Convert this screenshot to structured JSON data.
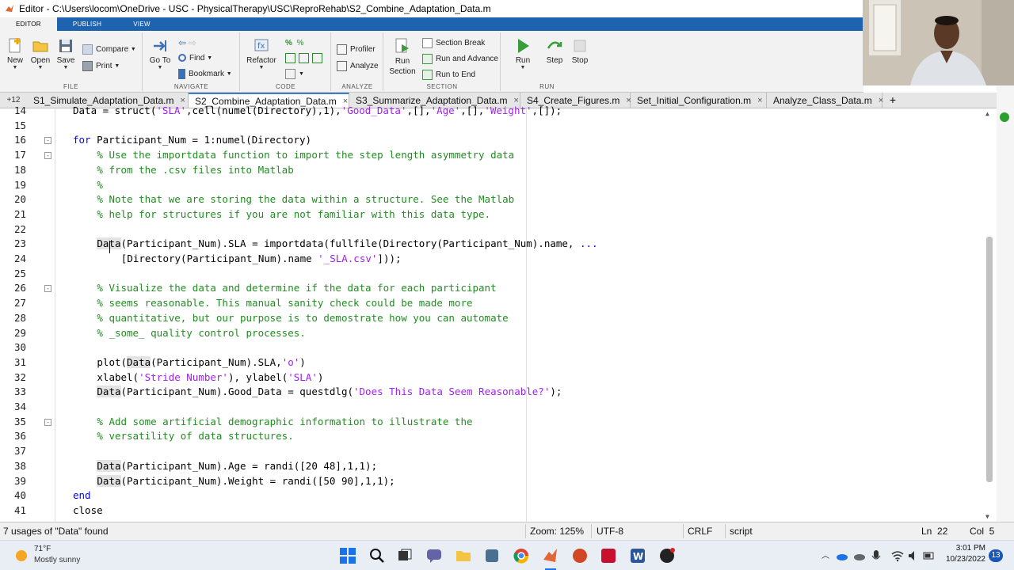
{
  "window": {
    "title": "Editor - C:\\Users\\locom\\OneDrive - USC - PhysicalTherapy\\USC\\ReproRehab\\S2_Combine_Adaptation_Data.m"
  },
  "toolstrip_tabs": [
    "EDITOR",
    "PUBLISH",
    "VIEW"
  ],
  "ribbon": {
    "file": {
      "label": "FILE",
      "new": "New",
      "open": "Open",
      "save": "Save",
      "compare": "Compare",
      "print": "Print"
    },
    "navigate": {
      "label": "NAVIGATE",
      "goto": "Go To",
      "find": "Find",
      "bookmark": "Bookmark"
    },
    "code": {
      "label": "CODE",
      "refactor": "Refactor"
    },
    "analyze": {
      "label": "ANALYZE",
      "profiler": "Profiler",
      "analyze": "Analyze"
    },
    "section": {
      "label": "SECTION",
      "run_section": "Run\nSection",
      "section_break": "Section Break",
      "run_and_advance": "Run and Advance",
      "run_to_end": "Run to End"
    },
    "run": {
      "label": "RUN",
      "run": "Run",
      "step": "Step",
      "stop": "Stop"
    }
  },
  "doc_tabs": {
    "overflow": "+12",
    "items": [
      {
        "label": "S1_Simulate_Adaptation_Data.m",
        "active": false
      },
      {
        "label": "S2_Combine_Adaptation_Data.m",
        "active": true
      },
      {
        "label": "S3_Summarize_Adaptation_Data.m",
        "active": false
      },
      {
        "label": "S4_Create_Figures.m",
        "active": false
      },
      {
        "label": "Set_Initial_Configuration.m",
        "active": false
      },
      {
        "label": "Analyze_Class_Data.m",
        "active": false
      }
    ],
    "add": "+"
  },
  "code_lines": [
    {
      "n": "14",
      "html": "Data = struct(<span class='str'>'SLA'</span>,cell(numel(Directory),1),<span class='str'>'Good_Data'</span>,[],<span class='str'>'Age'</span>,[],<span class='str'>'Weight'</span>,[]);",
      "indent": 0
    },
    {
      "n": "15",
      "html": "",
      "indent": 0
    },
    {
      "n": "16",
      "html": "<span class='kw'>for</span> Participant_Num = 1:numel(Directory)",
      "indent": 0,
      "fold": "-"
    },
    {
      "n": "17",
      "html": "<span class='cmt'>% Use the importdata function to import the step length asymmetry data</span>",
      "indent": 4,
      "fold": "-"
    },
    {
      "n": "18",
      "html": "<span class='cmt'>% from the .csv files into Matlab</span>",
      "indent": 4
    },
    {
      "n": "19",
      "html": "<span class='cmt'>%</span>",
      "indent": 4
    },
    {
      "n": "20",
      "html": "<span class='cmt'>% Note that we are storing the data within a structure. See the Matlab</span>",
      "indent": 4
    },
    {
      "n": "21",
      "html": "<span class='cmt'>% help for structures if you are not familiar with this data type.</span>",
      "indent": 4
    },
    {
      "n": "22",
      "html": "",
      "indent": 0
    },
    {
      "n": "23",
      "html": "<span class='hl'>Data</span>(Participant_Num).SLA = importdata(fullfile(Directory(Participant_Num).name, <span class='kw'>...</span>",
      "indent": 4
    },
    {
      "n": "24",
      "html": "[Directory(Participant_Num).name <span class='str'>'_SLA.csv'</span>]));",
      "indent": 8
    },
    {
      "n": "25",
      "html": "",
      "indent": 0
    },
    {
      "n": "26",
      "html": "<span class='cmt'>% Visualize the data and determine if the data for each participant</span>",
      "indent": 4,
      "fold": "-"
    },
    {
      "n": "27",
      "html": "<span class='cmt'>% seems reasonable. This manual sanity check could be made more</span>",
      "indent": 4
    },
    {
      "n": "28",
      "html": "<span class='cmt'>% quantitative, but our purpose is to demostrate how you can automate</span>",
      "indent": 4
    },
    {
      "n": "29",
      "html": "<span class='cmt'>% _some_ quality control processes.</span>",
      "indent": 4
    },
    {
      "n": "30",
      "html": "",
      "indent": 0
    },
    {
      "n": "31",
      "html": "plot(<span class='hl'>Data</span>(Participant_Num).SLA,<span class='str'>'o'</span>)",
      "indent": 4
    },
    {
      "n": "32",
      "html": "xlabel(<span class='str'>'Stride Number'</span>), ylabel(<span class='str'>'SLA'</span>)",
      "indent": 4
    },
    {
      "n": "33",
      "html": "<span class='hl'>Data</span>(Participant_Num).Good_Data = questdlg(<span class='str'>'Does This Data Seem Reasonable?'</span>);",
      "indent": 4
    },
    {
      "n": "34",
      "html": "",
      "indent": 0
    },
    {
      "n": "35",
      "html": "<span class='cmt'>% Add some artificial demographic information to illustrate the</span>",
      "indent": 4,
      "fold": "-"
    },
    {
      "n": "36",
      "html": "<span class='cmt'>% versatility of data structures.</span>",
      "indent": 4
    },
    {
      "n": "37",
      "html": "",
      "indent": 0
    },
    {
      "n": "38",
      "html": "<span class='hl'>Data</span>(Participant_Num).Age = randi([20 48],1,1);",
      "indent": 4
    },
    {
      "n": "39",
      "html": "<span class='hl'>Data</span>(Participant_Num).Weight = randi([50 90],1,1);",
      "indent": 4
    },
    {
      "n": "40",
      "html": "<span class='kw'>end</span>",
      "indent": 0
    },
    {
      "n": "41",
      "html": "close",
      "indent": 0
    }
  ],
  "status": {
    "message": "7 usages of \"Data\" found",
    "zoom": "Zoom: 125%",
    "encoding": "UTF-8",
    "eol": "CRLF",
    "type": "script",
    "line": "Ln  22",
    "col": "Col  5"
  },
  "taskbar": {
    "weather_temp": "71°F",
    "weather_desc": "Mostly sunny",
    "time": "3:01 PM",
    "date": "10/23/2022",
    "notifications": "13"
  },
  "colors": {
    "ribbon_blue": "#1d63b0",
    "comment": "#228b22",
    "string": "#a020f0",
    "keyword": "#0000ff"
  }
}
